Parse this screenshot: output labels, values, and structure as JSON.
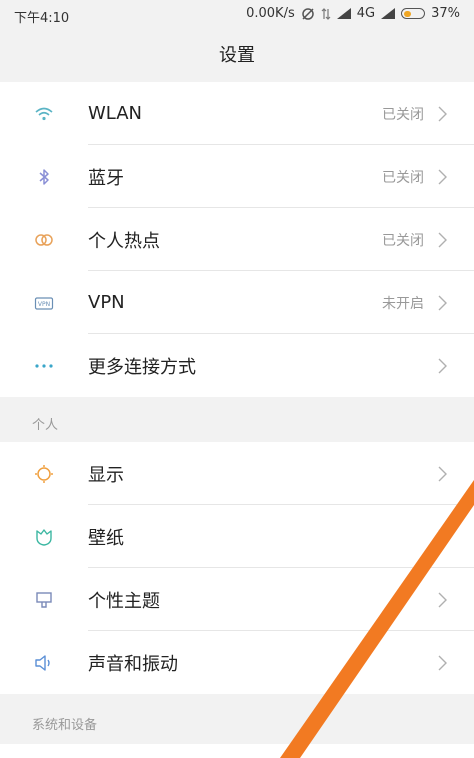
{
  "status_bar": {
    "time": "下午4:10",
    "net_speed": "0.00K/s",
    "network": "4G",
    "battery_text": "37%",
    "battery_level": 0.37,
    "battery_color": "#f0a623"
  },
  "title": "设置",
  "network_items": [
    {
      "icon": "wifi-icon",
      "label": "WLAN",
      "value": "已关闭",
      "icon_color": "#5ab4c5"
    },
    {
      "icon": "bluetooth-icon",
      "label": "蓝牙",
      "value": "已关闭",
      "icon_color": "#8a8fd6"
    },
    {
      "icon": "hotspot-icon",
      "label": "个人热点",
      "value": "已关闭",
      "icon_color": "#e8a25a"
    },
    {
      "icon": "vpn-icon",
      "label": "VPN",
      "value": "未开启",
      "icon_color": "#6a8fb5"
    },
    {
      "icon": "more-icon",
      "label": "更多连接方式",
      "value": "",
      "icon_color": "#3aa6c9"
    }
  ],
  "personal_header": "个人",
  "personal_items": [
    {
      "icon": "display-icon",
      "label": "显示",
      "icon_color": "#f0a040"
    },
    {
      "icon": "wallpaper-icon",
      "label": "壁纸",
      "icon_color": "#3cb7a2"
    },
    {
      "icon": "theme-icon",
      "label": "个性主题",
      "icon_color": "#7a8ab8"
    },
    {
      "icon": "sound-icon",
      "label": "声音和振动",
      "icon_color": "#5a8fd6"
    }
  ],
  "system_header": "系统和设备",
  "annotation_color": "#f27a22"
}
